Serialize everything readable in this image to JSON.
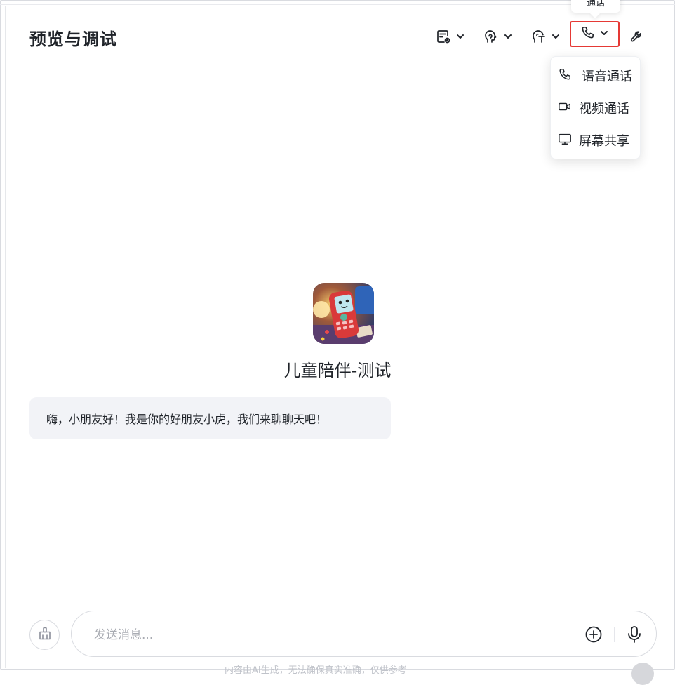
{
  "header": {
    "title": "预览与调试"
  },
  "toolbar": {
    "items": [
      {
        "icon": "doc-settings-icon"
      },
      {
        "icon": "voice-head-icon"
      },
      {
        "icon": "tts-icon"
      },
      {
        "icon": "phone-icon"
      },
      {
        "icon": "wrench-icon"
      }
    ],
    "tooltip_label": "通话",
    "accent_color": "#e53935"
  },
  "call_menu": {
    "items": [
      {
        "label": "语音通话",
        "icon": "phone-icon"
      },
      {
        "label": "视频通话",
        "icon": "video-camera-icon"
      },
      {
        "label": "屏幕共享",
        "icon": "monitor-icon"
      }
    ]
  },
  "bot": {
    "name": "儿童陪伴-测试",
    "greeting": "嗨，小朋友好！我是你的好朋友小虎，我们来聊聊天吧！"
  },
  "composer": {
    "placeholder": "发送消息...",
    "footnote": "内容由AI生成，无法确保真实准确，仅供参考"
  }
}
